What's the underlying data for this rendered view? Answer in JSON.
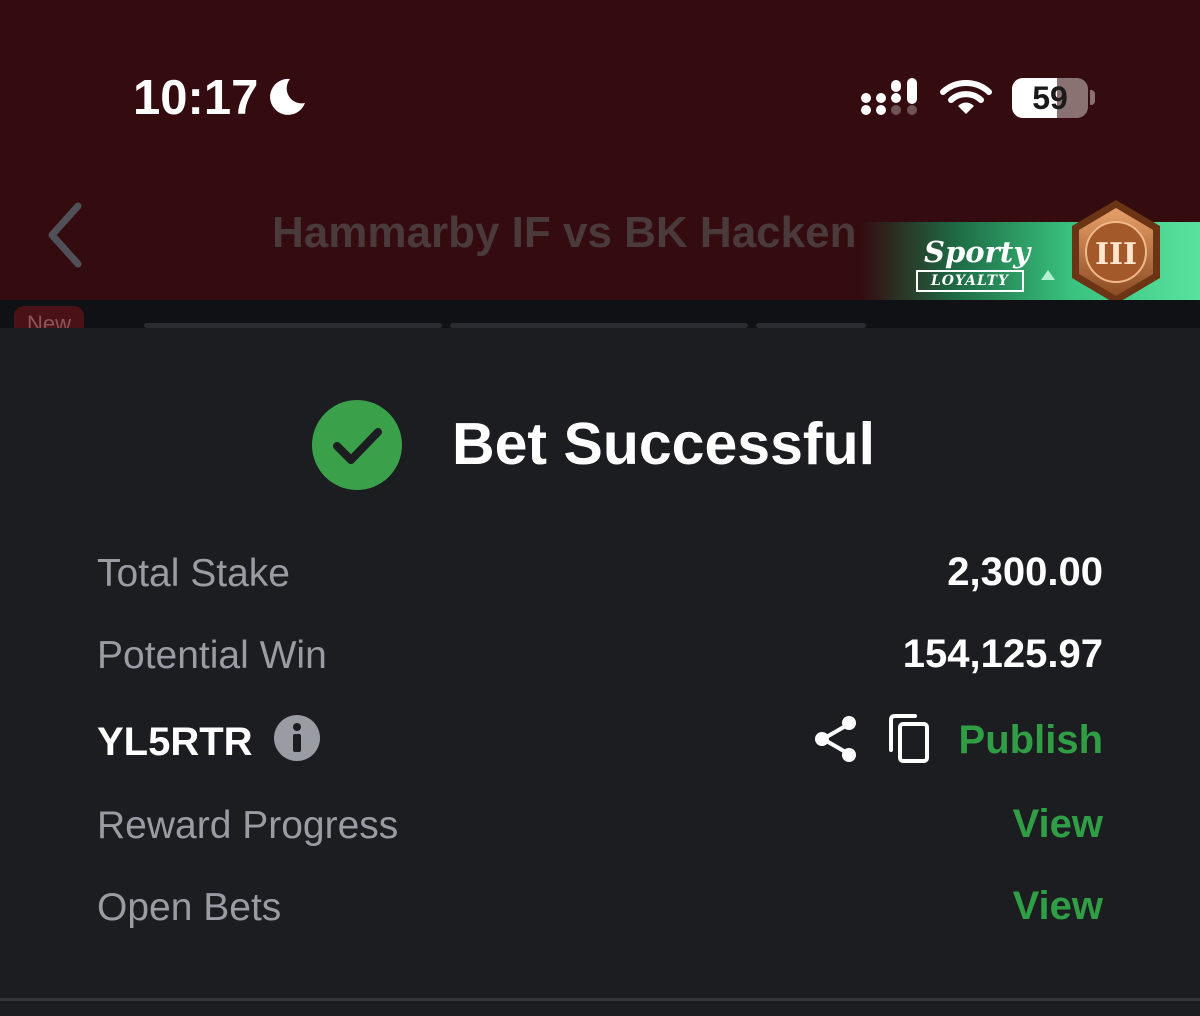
{
  "status_bar": {
    "time": "10:17",
    "battery_percent": "59",
    "battery_level": 0.59,
    "icons": [
      "moon-icon",
      "signal-icon",
      "wifi-icon",
      "battery-icon"
    ]
  },
  "header": {
    "back_icon": "chevron-left-icon",
    "title": "Hammarby IF vs BK Hacken",
    "new_badge": "New"
  },
  "loyalty": {
    "brand": "Sporty",
    "program": "LOYALTY",
    "tier": "III",
    "progress": 0.7,
    "icons": [
      "arrow-up-icon",
      "tier-badge-icon"
    ]
  },
  "result": {
    "status_icon": "check-circle-icon",
    "title": "Bet Successful",
    "total_stake_label": "Total Stake",
    "total_stake_value": "2,300.00",
    "potential_win_label": "Potential Win",
    "potential_win_value": "154,125.97",
    "booking_code": "YL5RTR",
    "publish_label": "Publish",
    "reward_progress_label": "Reward Progress",
    "reward_progress_link": "View",
    "open_bets_label": "Open Bets",
    "open_bets_link": "View",
    "icons": [
      "info-icon",
      "share-icon",
      "copy-icon"
    ]
  },
  "colors": {
    "header_bg": "#340b0e",
    "panel_bg": "#1c1d21",
    "success_green": "#3aa14a",
    "link_green": "#2f9e44",
    "label_gray": "#9a9ca4"
  }
}
